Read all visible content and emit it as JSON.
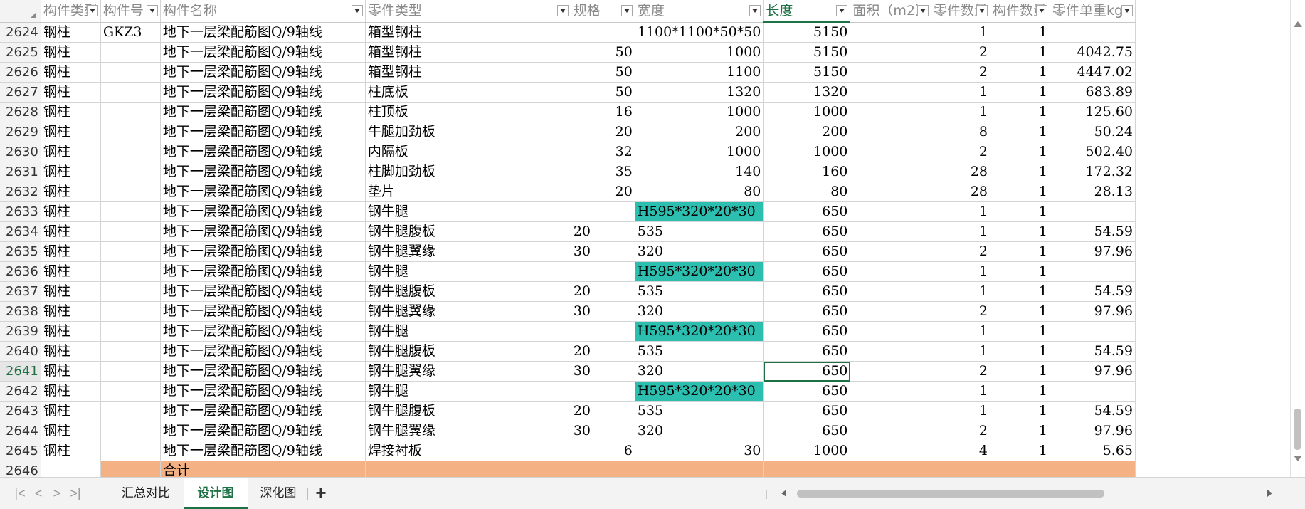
{
  "columns": [
    "构件类型",
    "构件号",
    "构件名称",
    "零件类型",
    "规格",
    "宽度",
    "长度",
    "面积（m2）",
    "零件数量",
    "构件数量",
    "零件单重kg"
  ],
  "rows": [
    {
      "n": "2624",
      "c": [
        "钢柱",
        "GKZ3",
        "地下一层梁配筋图Q/9轴线",
        "箱型钢柱",
        "",
        "1100*1100*50*50",
        "5150",
        "",
        "1",
        "1",
        ""
      ]
    },
    {
      "n": "2625",
      "c": [
        "钢柱",
        "",
        "地下一层梁配筋图Q/9轴线",
        "箱型钢柱",
        "50",
        "1000",
        "5150",
        "",
        "2",
        "1",
        "4042.75"
      ]
    },
    {
      "n": "2626",
      "c": [
        "钢柱",
        "",
        "地下一层梁配筋图Q/9轴线",
        "箱型钢柱",
        "50",
        "1100",
        "5150",
        "",
        "2",
        "1",
        "4447.02"
      ]
    },
    {
      "n": "2627",
      "c": [
        "钢柱",
        "",
        "地下一层梁配筋图Q/9轴线",
        "柱底板",
        "50",
        "1320",
        "1320",
        "",
        "1",
        "1",
        "683.89"
      ]
    },
    {
      "n": "2628",
      "c": [
        "钢柱",
        "",
        "地下一层梁配筋图Q/9轴线",
        "柱顶板",
        "16",
        "1000",
        "1000",
        "",
        "1",
        "1",
        "125.60"
      ]
    },
    {
      "n": "2629",
      "c": [
        "钢柱",
        "",
        "地下一层梁配筋图Q/9轴线",
        "牛腿加劲板",
        "20",
        "200",
        "200",
        "",
        "8",
        "1",
        "50.24"
      ]
    },
    {
      "n": "2630",
      "c": [
        "钢柱",
        "",
        "地下一层梁配筋图Q/9轴线",
        "内隔板",
        "32",
        "1000",
        "1000",
        "",
        "2",
        "1",
        "502.40"
      ]
    },
    {
      "n": "2631",
      "c": [
        "钢柱",
        "",
        "地下一层梁配筋图Q/9轴线",
        "柱脚加劲板",
        "35",
        "140",
        "160",
        "",
        "28",
        "1",
        "172.32"
      ]
    },
    {
      "n": "2632",
      "c": [
        "钢柱",
        "",
        "地下一层梁配筋图Q/9轴线",
        "垫片",
        "20",
        "80",
        "80",
        "",
        "28",
        "1",
        "28.13"
      ]
    },
    {
      "n": "2633",
      "c": [
        "钢柱",
        "",
        "地下一层梁配筋图Q/9轴线",
        "钢牛腿",
        "",
        "H595*320*20*30",
        "650",
        "",
        "1",
        "1",
        ""
      ]
    },
    {
      "n": "2634",
      "c": [
        "钢柱",
        "",
        "地下一层梁配筋图Q/9轴线",
        "钢牛腿腹板",
        "20",
        "535",
        "650",
        "",
        "1",
        "1",
        "54.59"
      ]
    },
    {
      "n": "2635",
      "c": [
        "钢柱",
        "",
        "地下一层梁配筋图Q/9轴线",
        "钢牛腿翼缘",
        "30",
        "320",
        "650",
        "",
        "2",
        "1",
        "97.96"
      ]
    },
    {
      "n": "2636",
      "c": [
        "钢柱",
        "",
        "地下一层梁配筋图Q/9轴线",
        "钢牛腿",
        "",
        "H595*320*20*30",
        "650",
        "",
        "1",
        "1",
        ""
      ]
    },
    {
      "n": "2637",
      "c": [
        "钢柱",
        "",
        "地下一层梁配筋图Q/9轴线",
        "钢牛腿腹板",
        "20",
        "535",
        "650",
        "",
        "1",
        "1",
        "54.59"
      ]
    },
    {
      "n": "2638",
      "c": [
        "钢柱",
        "",
        "地下一层梁配筋图Q/9轴线",
        "钢牛腿翼缘",
        "30",
        "320",
        "650",
        "",
        "2",
        "1",
        "97.96"
      ]
    },
    {
      "n": "2639",
      "c": [
        "钢柱",
        "",
        "地下一层梁配筋图Q/9轴线",
        "钢牛腿",
        "",
        "H595*320*20*30",
        "650",
        "",
        "1",
        "1",
        ""
      ]
    },
    {
      "n": "2640",
      "c": [
        "钢柱",
        "",
        "地下一层梁配筋图Q/9轴线",
        "钢牛腿腹板",
        "20",
        "535",
        "650",
        "",
        "1",
        "1",
        "54.59"
      ]
    },
    {
      "n": "2641",
      "c": [
        "钢柱",
        "",
        "地下一层梁配筋图Q/9轴线",
        "钢牛腿翼缘",
        "30",
        "320",
        "650",
        "",
        "2",
        "1",
        "97.96"
      ]
    },
    {
      "n": "2642",
      "c": [
        "钢柱",
        "",
        "地下一层梁配筋图Q/9轴线",
        "钢牛腿",
        "",
        "H595*320*20*30",
        "650",
        "",
        "1",
        "1",
        ""
      ]
    },
    {
      "n": "2643",
      "c": [
        "钢柱",
        "",
        "地下一层梁配筋图Q/9轴线",
        "钢牛腿腹板",
        "20",
        "535",
        "650",
        "",
        "1",
        "1",
        "54.59"
      ]
    },
    {
      "n": "2644",
      "c": [
        "钢柱",
        "",
        "地下一层梁配筋图Q/9轴线",
        "钢牛腿翼缘",
        "30",
        "320",
        "650",
        "",
        "2",
        "1",
        "97.96"
      ]
    },
    {
      "n": "2645",
      "c": [
        "钢柱",
        "",
        "地下一层梁配筋图Q/9轴线",
        "焊接衬板",
        "6",
        "30",
        "1000",
        "",
        "4",
        "1",
        "5.65"
      ]
    }
  ],
  "total_row": {
    "n": "2646",
    "label": "合计"
  },
  "active_row": "2641",
  "active_column": "长度",
  "colors": {
    "highlight_teal": "#2cbfb0",
    "total_orange": "#f4b183",
    "accent_green": "#1e7145"
  },
  "sheet_tabs": [
    {
      "label": "汇总对比",
      "active": false
    },
    {
      "label": "设计图",
      "active": true
    },
    {
      "label": "深化图",
      "active": false
    }
  ],
  "icons": {
    "first": "first-sheet-icon",
    "prev": "prev-sheet-icon",
    "next": "next-sheet-icon",
    "last": "last-sheet-icon",
    "add": "add-sheet-icon"
  }
}
